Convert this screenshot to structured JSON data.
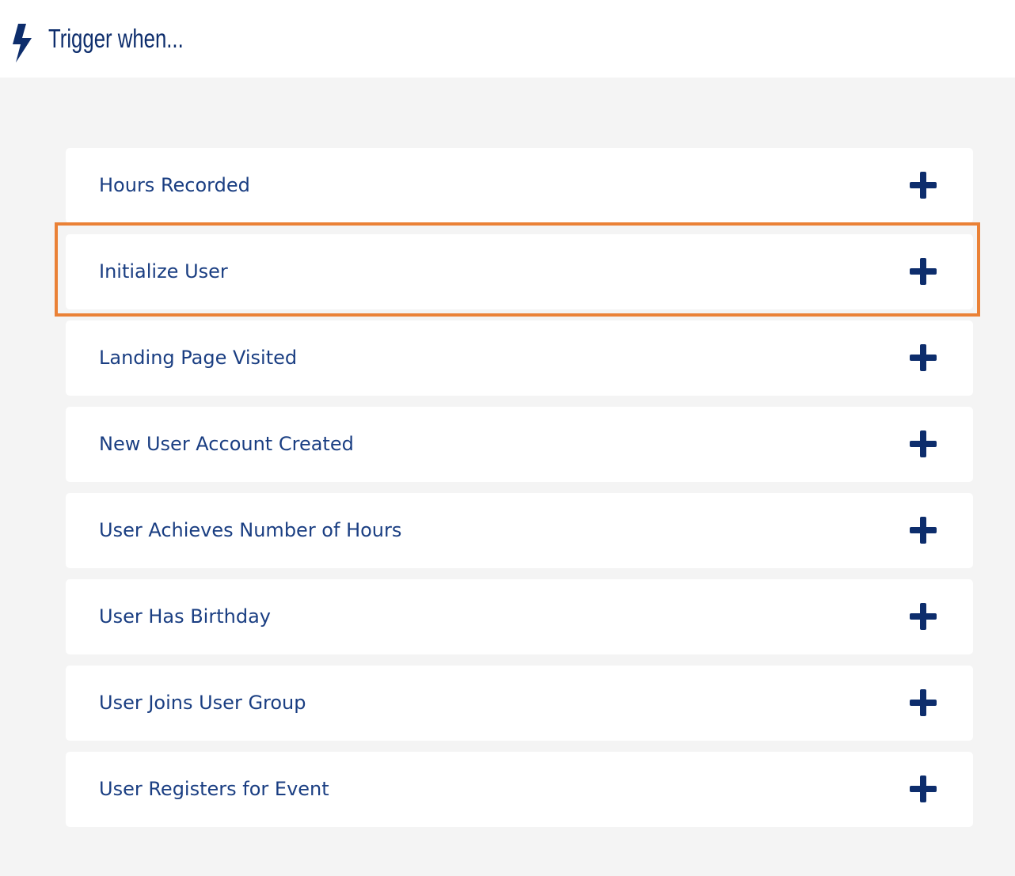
{
  "header": {
    "icon": "lightning-bolt-icon",
    "title": "Trigger when..."
  },
  "triggers": [
    {
      "label": "Hours Recorded",
      "icon": "plus-icon"
    },
    {
      "label": "Initialize User",
      "icon": "plus-icon",
      "highlighted": true
    },
    {
      "label": "Landing Page Visited",
      "icon": "plus-icon"
    },
    {
      "label": "New User Account Created",
      "icon": "plus-icon"
    },
    {
      "label": "User Achieves Number of Hours",
      "icon": "plus-icon"
    },
    {
      "label": "User Has Birthday",
      "icon": "plus-icon"
    },
    {
      "label": "User Joins User Group",
      "icon": "plus-icon"
    },
    {
      "label": "User Registers for Event",
      "icon": "plus-icon"
    }
  ],
  "colors": {
    "primary": "#0d2d6c",
    "label": "#1a3e82",
    "background": "#f4f4f4",
    "card": "#ffffff",
    "highlight": "#ea8136"
  }
}
